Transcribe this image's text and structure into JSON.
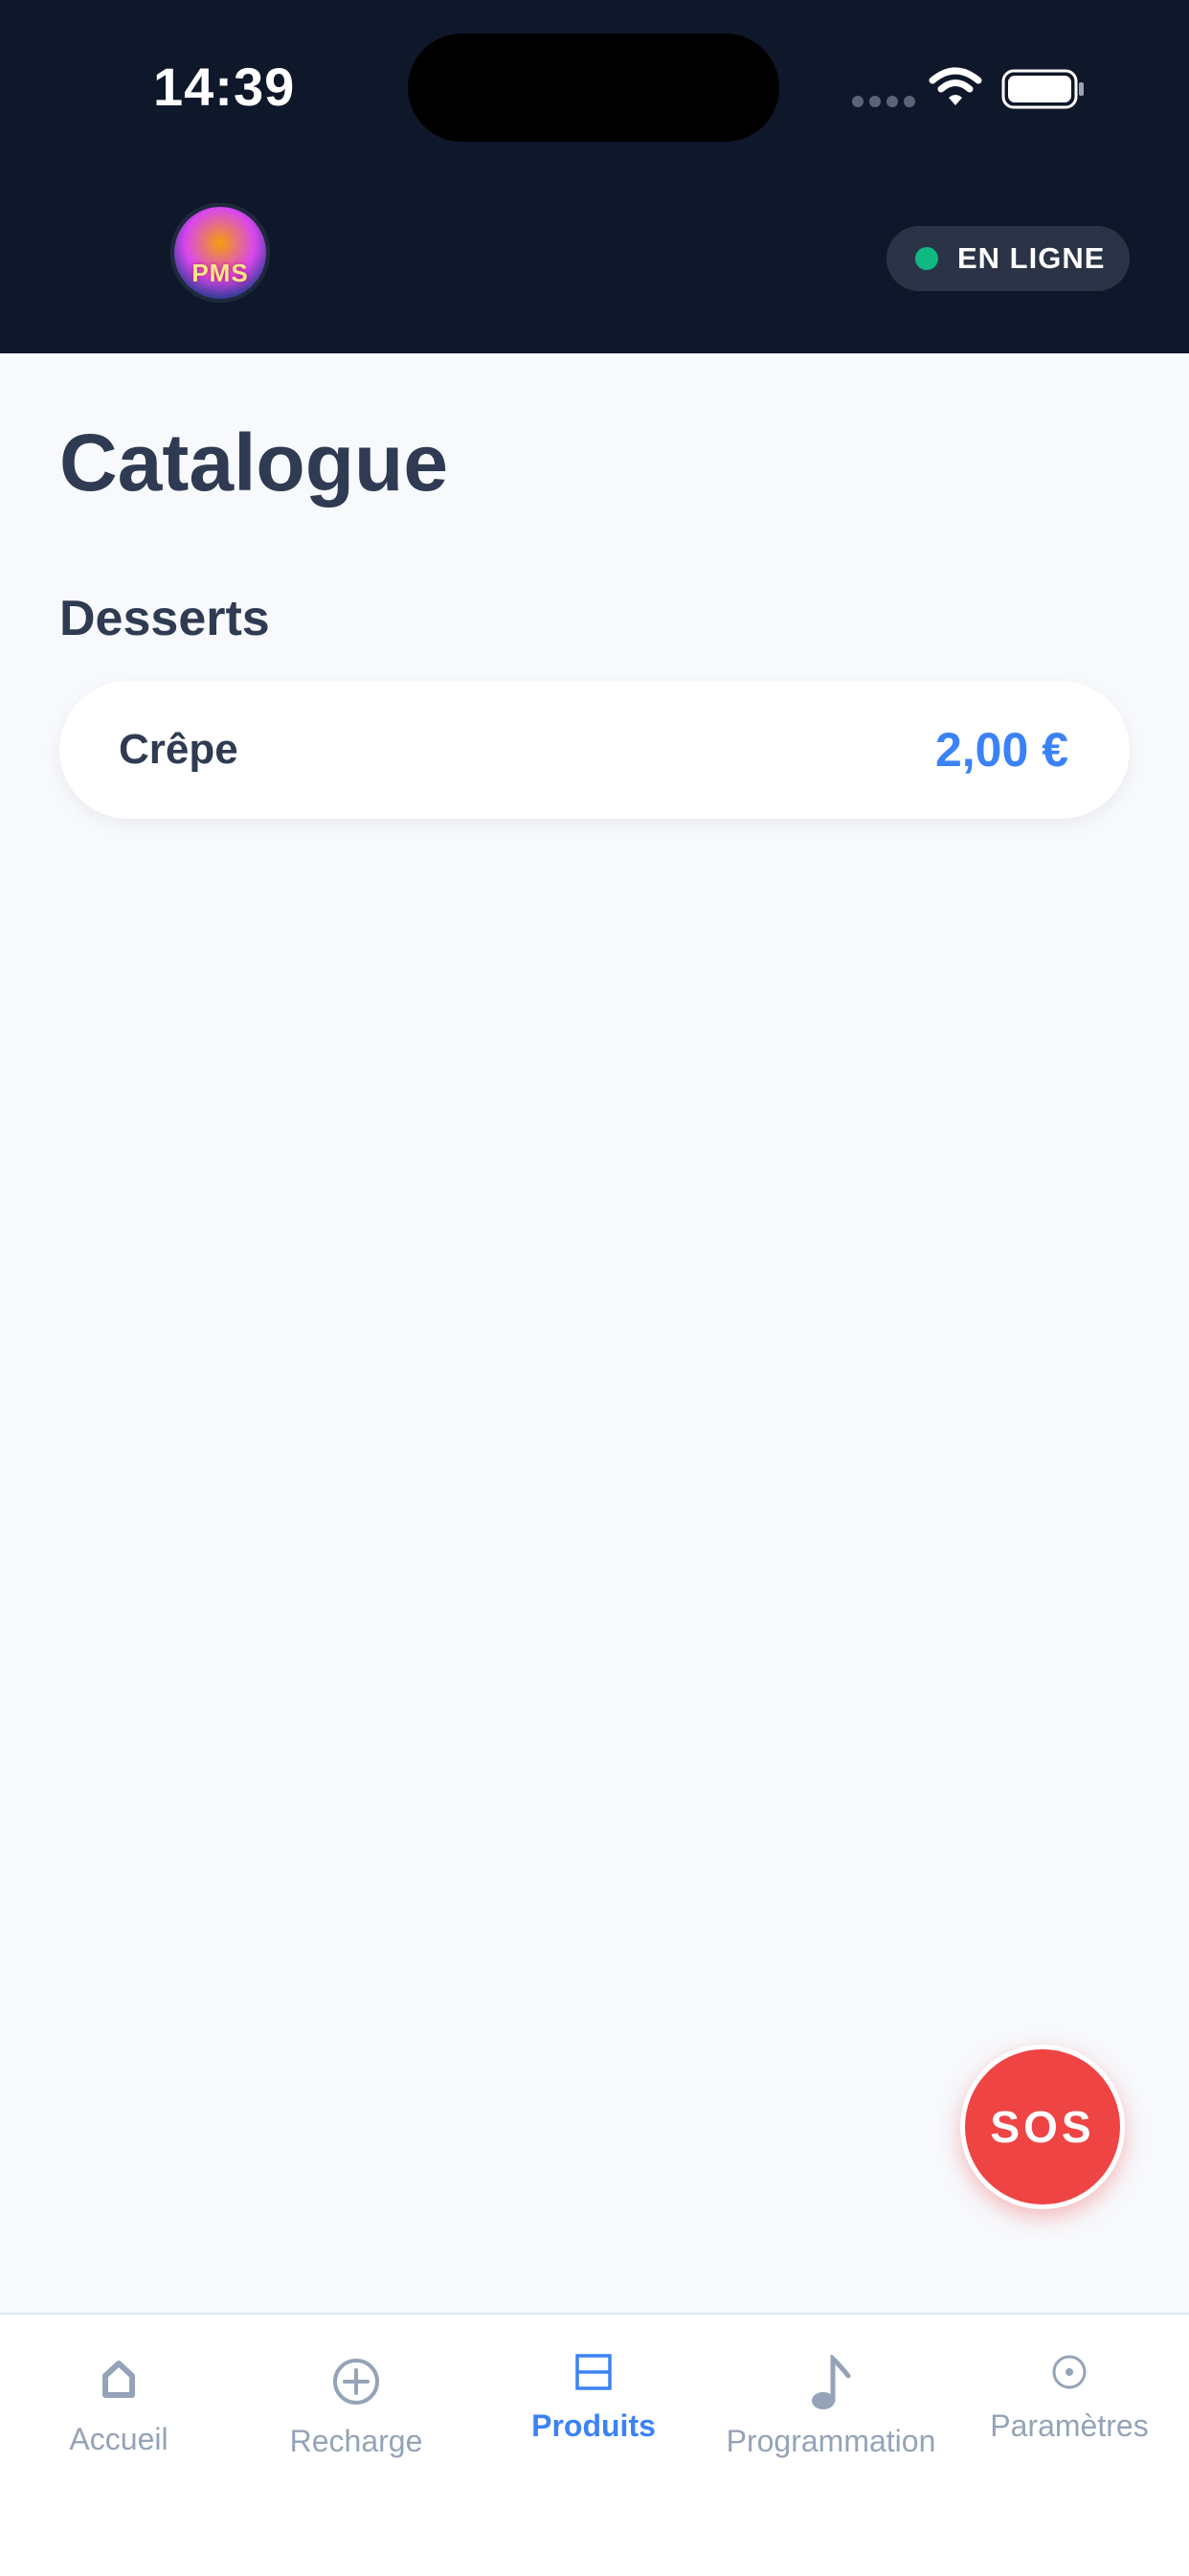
{
  "status_bar": {
    "time": "14:39"
  },
  "header": {
    "logo_text": "PMS",
    "status_label": "EN LIGNE",
    "status_color": "#10b981"
  },
  "main": {
    "title": "Catalogue",
    "sections": [
      {
        "title": "Desserts",
        "items": [
          {
            "name": "Crêpe",
            "price": "2,00 €"
          }
        ]
      }
    ]
  },
  "sos": {
    "label": "SOS",
    "color": "#ef4444"
  },
  "nav": {
    "active": "Produits",
    "accent": "#3b82f6",
    "items": [
      {
        "label": "Accueil",
        "icon": "home-icon"
      },
      {
        "label": "Recharge",
        "icon": "plus-circle-icon"
      },
      {
        "label": "Produits",
        "icon": "products-icon"
      },
      {
        "label": "Programmation",
        "icon": "music-note-icon"
      },
      {
        "label": "Paramètres",
        "icon": "settings-circle-icon"
      }
    ]
  }
}
